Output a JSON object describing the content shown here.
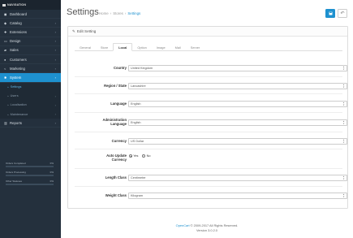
{
  "sidebar": {
    "header": "NAVIGATION",
    "items": [
      {
        "label": "Dashboard",
        "icon": "dashboard-icon",
        "glyph": "◼",
        "chev": ""
      },
      {
        "label": "Catalog",
        "icon": "tag-icon",
        "glyph": "◆",
        "chev": "›"
      },
      {
        "label": "Extensions",
        "icon": "puzzle-icon",
        "glyph": "✚",
        "chev": "›"
      },
      {
        "label": "Design",
        "icon": "monitor-icon",
        "glyph": "▭",
        "chev": "›"
      },
      {
        "label": "Sales",
        "icon": "cart-icon",
        "glyph": "▰",
        "chev": "›"
      },
      {
        "label": "Customers",
        "icon": "user-icon",
        "glyph": "●",
        "chev": "›"
      },
      {
        "label": "Marketing",
        "icon": "share-icon",
        "glyph": "<",
        "chev": "›"
      },
      {
        "label": "System",
        "icon": "cog-icon",
        "glyph": "✱",
        "chev": "›"
      }
    ],
    "system_sub": [
      {
        "label": "Settings",
        "chev": ""
      },
      {
        "label": "Users",
        "chev": "›"
      },
      {
        "label": "Localisation",
        "chev": "›"
      },
      {
        "label": "Maintenance",
        "chev": "›"
      }
    ],
    "reports": {
      "label": "Reports",
      "icon": "bar-chart-icon",
      "glyph": "▥",
      "chev": "›"
    },
    "stats": [
      {
        "label": "Orders Completed",
        "value": "0%"
      },
      {
        "label": "Orders Processing",
        "value": "0%"
      },
      {
        "label": "Other Statuses",
        "value": "0%"
      }
    ]
  },
  "header": {
    "title": "Settings",
    "breadcrumb": [
      "Home",
      "Stores",
      "Settings"
    ],
    "save_icon": "save-icon",
    "back_icon": "reply-icon"
  },
  "panel": {
    "heading": "Edit Setting",
    "heading_icon": "pencil-icon",
    "tabs": [
      "General",
      "Store",
      "Local",
      "Option",
      "Image",
      "Mail",
      "Server"
    ],
    "active_tab": "Local"
  },
  "form": {
    "country": {
      "label": "Country",
      "value": "United Kingdom"
    },
    "region": {
      "label": "Region / State",
      "value": "Lancashire"
    },
    "language": {
      "label": "Language",
      "value": "English"
    },
    "admin_language": {
      "label": "Administration Language",
      "value": "English"
    },
    "currency": {
      "label": "Currency",
      "value": "US Dollar"
    },
    "auto_update": {
      "label": "Auto Update Currency",
      "yes": "Yes",
      "no": "No",
      "selected": "Yes"
    },
    "length_class": {
      "label": "Length Class",
      "value": "Centimeter"
    },
    "weight_class": {
      "label": "Weight Class",
      "value": "Kilogram"
    }
  },
  "footer": {
    "brand": "OpenCart",
    "copyright": "© 2009-2017 All Rights Reserved.",
    "version": "Version 3.0.2.0"
  },
  "colors": {
    "accent": "#1e91cf",
    "sidebar": "#24303d",
    "required": "#f56b6b"
  }
}
